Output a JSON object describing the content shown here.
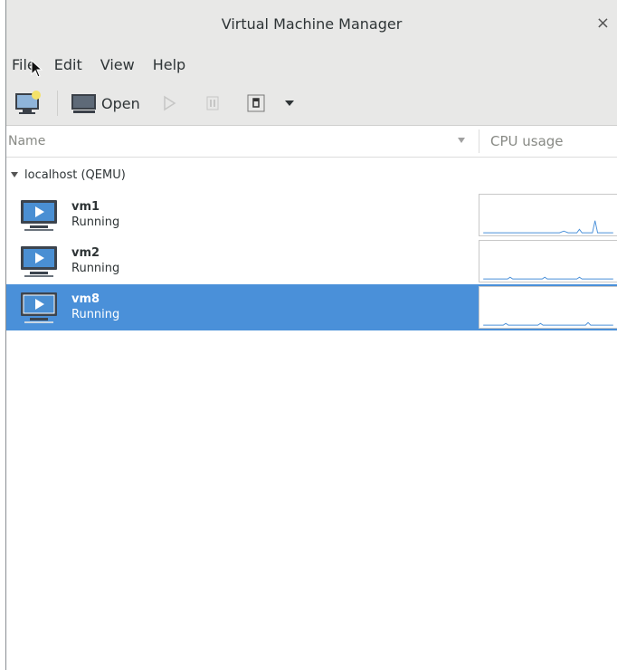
{
  "window": {
    "title": "Virtual Machine Manager",
    "close_glyph": "×"
  },
  "menu": [
    "File",
    "Edit",
    "View",
    "Help"
  ],
  "toolbar": {
    "new_vm_icon": "new-vm-icon",
    "open_label": "Open",
    "run_icon": "play-icon",
    "pause_icon": "pause-icon",
    "shutdown_icon": "shutdown-icon",
    "dropdown_icon": "chevron-down-icon"
  },
  "columns": {
    "name": "Name",
    "cpu": "CPU usage"
  },
  "host": {
    "label": "localhost (QEMU)"
  },
  "vms": [
    {
      "name": "vm1",
      "state": "Running",
      "selected": false
    },
    {
      "name": "vm2",
      "state": "Running",
      "selected": false
    },
    {
      "name": "vm8",
      "state": "Running",
      "selected": true
    }
  ],
  "colors": {
    "selection": "#4a90d9",
    "graph_line": "#4a90d9",
    "chrome": "#e8e8e7"
  }
}
